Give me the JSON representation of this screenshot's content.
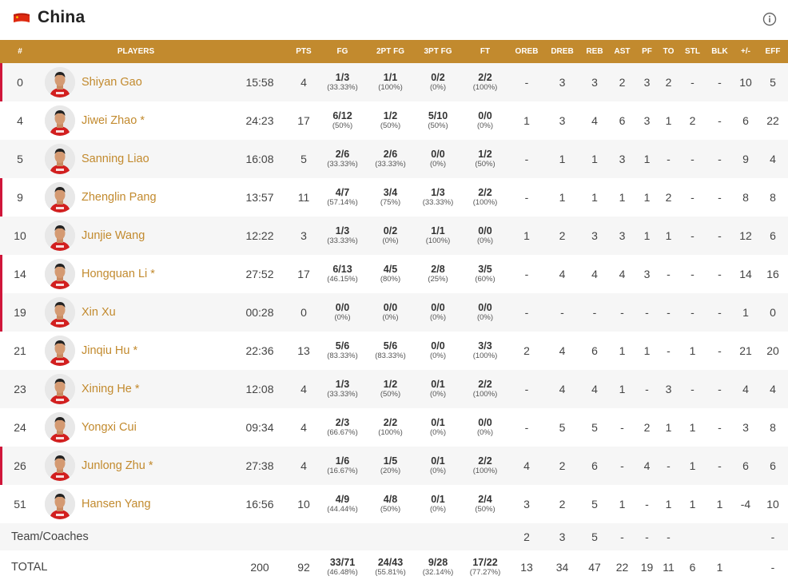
{
  "team": {
    "name": "China",
    "colors": {
      "accent": "#c28a2e",
      "starter": "#d0163a",
      "flag": "#de2910",
      "flagStar": "#ffde00"
    }
  },
  "columns": [
    "#",
    "PLAYERS",
    "",
    "PTS",
    "FG",
    "2PT FG",
    "3PT FG",
    "FT",
    "OREB",
    "DREB",
    "REB",
    "AST",
    "PF",
    "TO",
    "STL",
    "BLK",
    "+/-",
    "EFF"
  ],
  "players": [
    {
      "num": "0",
      "name": "Shiyan Gao",
      "min": "15:58",
      "pts": "4",
      "fg": [
        "1/3",
        "(33.33%)"
      ],
      "fg2": [
        "1/1",
        "(100%)"
      ],
      "fg3": [
        "0/2",
        "(0%)"
      ],
      "ft": [
        "2/2",
        "(100%)"
      ],
      "oreb": "-",
      "dreb": "3",
      "reb": "3",
      "ast": "2",
      "pf": "3",
      "to": "2",
      "stl": "-",
      "blk": "-",
      "pm": "10",
      "eff": "5",
      "starter": true
    },
    {
      "num": "4",
      "name": "Jiwei Zhao *",
      "min": "24:23",
      "pts": "17",
      "fg": [
        "6/12",
        "(50%)"
      ],
      "fg2": [
        "1/2",
        "(50%)"
      ],
      "fg3": [
        "5/10",
        "(50%)"
      ],
      "ft": [
        "0/0",
        "(0%)"
      ],
      "oreb": "1",
      "dreb": "3",
      "reb": "4",
      "ast": "6",
      "pf": "3",
      "to": "1",
      "stl": "2",
      "blk": "-",
      "pm": "6",
      "eff": "22",
      "starter": false
    },
    {
      "num": "5",
      "name": "Sanning Liao",
      "min": "16:08",
      "pts": "5",
      "fg": [
        "2/6",
        "(33.33%)"
      ],
      "fg2": [
        "2/6",
        "(33.33%)"
      ],
      "fg3": [
        "0/0",
        "(0%)"
      ],
      "ft": [
        "1/2",
        "(50%)"
      ],
      "oreb": "-",
      "dreb": "1",
      "reb": "1",
      "ast": "3",
      "pf": "1",
      "to": "-",
      "stl": "-",
      "blk": "-",
      "pm": "9",
      "eff": "4",
      "starter": false
    },
    {
      "num": "9",
      "name": "Zhenglin Pang",
      "min": "13:57",
      "pts": "11",
      "fg": [
        "4/7",
        "(57.14%)"
      ],
      "fg2": [
        "3/4",
        "(75%)"
      ],
      "fg3": [
        "1/3",
        "(33.33%)"
      ],
      "ft": [
        "2/2",
        "(100%)"
      ],
      "oreb": "-",
      "dreb": "1",
      "reb": "1",
      "ast": "1",
      "pf": "1",
      "to": "2",
      "stl": "-",
      "blk": "-",
      "pm": "8",
      "eff": "8",
      "starter": true
    },
    {
      "num": "10",
      "name": "Junjie Wang",
      "min": "12:22",
      "pts": "3",
      "fg": [
        "1/3",
        "(33.33%)"
      ],
      "fg2": [
        "0/2",
        "(0%)"
      ],
      "fg3": [
        "1/1",
        "(100%)"
      ],
      "ft": [
        "0/0",
        "(0%)"
      ],
      "oreb": "1",
      "dreb": "2",
      "reb": "3",
      "ast": "3",
      "pf": "1",
      "to": "1",
      "stl": "-",
      "blk": "-",
      "pm": "12",
      "eff": "6",
      "starter": false
    },
    {
      "num": "14",
      "name": "Hongquan Li *",
      "min": "27:52",
      "pts": "17",
      "fg": [
        "6/13",
        "(46.15%)"
      ],
      "fg2": [
        "4/5",
        "(80%)"
      ],
      "fg3": [
        "2/8",
        "(25%)"
      ],
      "ft": [
        "3/5",
        "(60%)"
      ],
      "oreb": "-",
      "dreb": "4",
      "reb": "4",
      "ast": "4",
      "pf": "3",
      "to": "-",
      "stl": "-",
      "blk": "-",
      "pm": "14",
      "eff": "16",
      "starter": true
    },
    {
      "num": "19",
      "name": "Xin Xu",
      "min": "00:28",
      "pts": "0",
      "fg": [
        "0/0",
        "(0%)"
      ],
      "fg2": [
        "0/0",
        "(0%)"
      ],
      "fg3": [
        "0/0",
        "(0%)"
      ],
      "ft": [
        "0/0",
        "(0%)"
      ],
      "oreb": "-",
      "dreb": "-",
      "reb": "-",
      "ast": "-",
      "pf": "-",
      "to": "-",
      "stl": "-",
      "blk": "-",
      "pm": "1",
      "eff": "0",
      "starter": true
    },
    {
      "num": "21",
      "name": "Jinqiu Hu *",
      "min": "22:36",
      "pts": "13",
      "fg": [
        "5/6",
        "(83.33%)"
      ],
      "fg2": [
        "5/6",
        "(83.33%)"
      ],
      "fg3": [
        "0/0",
        "(0%)"
      ],
      "ft": [
        "3/3",
        "(100%)"
      ],
      "oreb": "2",
      "dreb": "4",
      "reb": "6",
      "ast": "1",
      "pf": "1",
      "to": "-",
      "stl": "1",
      "blk": "-",
      "pm": "21",
      "eff": "20",
      "starter": false
    },
    {
      "num": "23",
      "name": "Xining He *",
      "min": "12:08",
      "pts": "4",
      "fg": [
        "1/3",
        "(33.33%)"
      ],
      "fg2": [
        "1/2",
        "(50%)"
      ],
      "fg3": [
        "0/1",
        "(0%)"
      ],
      "ft": [
        "2/2",
        "(100%)"
      ],
      "oreb": "-",
      "dreb": "4",
      "reb": "4",
      "ast": "1",
      "pf": "-",
      "to": "3",
      "stl": "-",
      "blk": "-",
      "pm": "4",
      "eff": "4",
      "starter": false
    },
    {
      "num": "24",
      "name": "Yongxi Cui",
      "min": "09:34",
      "pts": "4",
      "fg": [
        "2/3",
        "(66.67%)"
      ],
      "fg2": [
        "2/2",
        "(100%)"
      ],
      "fg3": [
        "0/1",
        "(0%)"
      ],
      "ft": [
        "0/0",
        "(0%)"
      ],
      "oreb": "-",
      "dreb": "5",
      "reb": "5",
      "ast": "-",
      "pf": "2",
      "to": "1",
      "stl": "1",
      "blk": "-",
      "pm": "3",
      "eff": "8",
      "starter": false
    },
    {
      "num": "26",
      "name": "Junlong Zhu *",
      "min": "27:38",
      "pts": "4",
      "fg": [
        "1/6",
        "(16.67%)"
      ],
      "fg2": [
        "1/5",
        "(20%)"
      ],
      "fg3": [
        "0/1",
        "(0%)"
      ],
      "ft": [
        "2/2",
        "(100%)"
      ],
      "oreb": "4",
      "dreb": "2",
      "reb": "6",
      "ast": "-",
      "pf": "4",
      "to": "-",
      "stl": "1",
      "blk": "-",
      "pm": "6",
      "eff": "6",
      "starter": true
    },
    {
      "num": "51",
      "name": "Hansen Yang",
      "min": "16:56",
      "pts": "10",
      "fg": [
        "4/9",
        "(44.44%)"
      ],
      "fg2": [
        "4/8",
        "(50%)"
      ],
      "fg3": [
        "0/1",
        "(0%)"
      ],
      "ft": [
        "2/4",
        "(50%)"
      ],
      "oreb": "3",
      "dreb": "2",
      "reb": "5",
      "ast": "1",
      "pf": "-",
      "to": "1",
      "stl": "1",
      "blk": "1",
      "pm": "-4",
      "eff": "10",
      "starter": false
    }
  ],
  "teamRow": {
    "label": "Team/Coaches",
    "oreb": "2",
    "dreb": "3",
    "reb": "5",
    "ast": "-",
    "pf": "-",
    "to": "-",
    "eff": "-"
  },
  "totalRow": {
    "label": "TOTAL",
    "min": "200",
    "pts": "92",
    "fg": [
      "33/71",
      "(46.48%)"
    ],
    "fg2": [
      "24/43",
      "(55.81%)"
    ],
    "fg3": [
      "9/28",
      "(32.14%)"
    ],
    "ft": [
      "17/22",
      "(77.27%)"
    ],
    "oreb": "13",
    "dreb": "34",
    "reb": "47",
    "ast": "22",
    "pf": "19",
    "to": "11",
    "stl": "6",
    "blk": "1",
    "pm": "",
    "eff": "-"
  }
}
